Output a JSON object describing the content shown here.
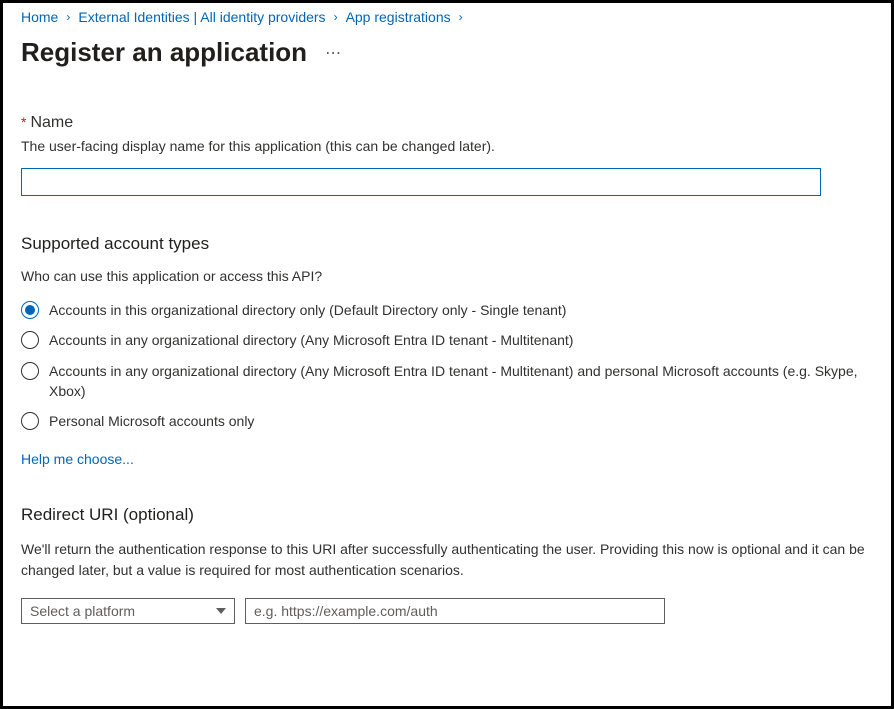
{
  "breadcrumb": {
    "items": [
      {
        "label": "Home"
      },
      {
        "label": "External Identities | All identity providers"
      },
      {
        "label": "App registrations"
      }
    ]
  },
  "pageTitle": "Register an application",
  "nameSection": {
    "label": "Name",
    "hint": "The user-facing display name for this application (this can be changed later).",
    "value": ""
  },
  "accountTypes": {
    "title": "Supported account types",
    "subtext": "Who can use this application or access this API?",
    "options": [
      {
        "label": "Accounts in this organizational directory only (Default Directory only - Single tenant)",
        "selected": true
      },
      {
        "label": "Accounts in any organizational directory (Any Microsoft Entra ID tenant - Multitenant)",
        "selected": false
      },
      {
        "label": "Accounts in any organizational directory (Any Microsoft Entra ID tenant - Multitenant) and personal Microsoft accounts (e.g. Skype, Xbox)",
        "selected": false
      },
      {
        "label": "Personal Microsoft accounts only",
        "selected": false
      }
    ],
    "helpLink": "Help me choose..."
  },
  "redirectUri": {
    "title": "Redirect URI (optional)",
    "description": "We'll return the authentication response to this URI after successfully authenticating the user. Providing this now is optional and it can be changed later, but a value is required for most authentication scenarios.",
    "platformPlaceholder": "Select a platform",
    "uriPlaceholder": "e.g. https://example.com/auth"
  }
}
